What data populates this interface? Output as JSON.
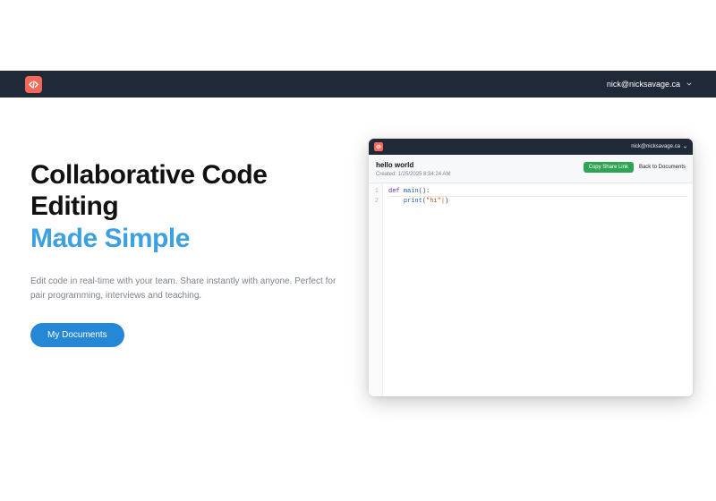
{
  "navbar": {
    "user_email": "nick@nicksavage.ca"
  },
  "hero": {
    "title_line1": "Collaborative Code",
    "title_line2": "Editing",
    "title_accent": "Made Simple",
    "subtitle": "Edit code in real-time with your team. Share instantly with anyone. Perfect for pair programming, interviews and teaching.",
    "cta_label": "My Documents"
  },
  "preview": {
    "user_email": "nick@nicksavage.ca",
    "doc_title": "hello world",
    "created_label": "Created: 1/25/2025 8:34:24 AM",
    "copy_label": "Copy Share Link",
    "back_label": "Back to Documents",
    "code": {
      "line_numbers": [
        "1",
        "2"
      ],
      "line1_kw": "def ",
      "line1_fn": "main",
      "line1_par": "():",
      "line2_indent": "    ",
      "line2_fn": "print",
      "line2_open": "(",
      "line2_str": "\"hi\"",
      "line2_close": ")"
    }
  },
  "colors": {
    "navbar_bg": "#1f2937",
    "logo_bg": "#f76858",
    "accent_text": "#3da0e3",
    "cta_bg": "#2687d6",
    "copy_bg": "#2fa452"
  }
}
